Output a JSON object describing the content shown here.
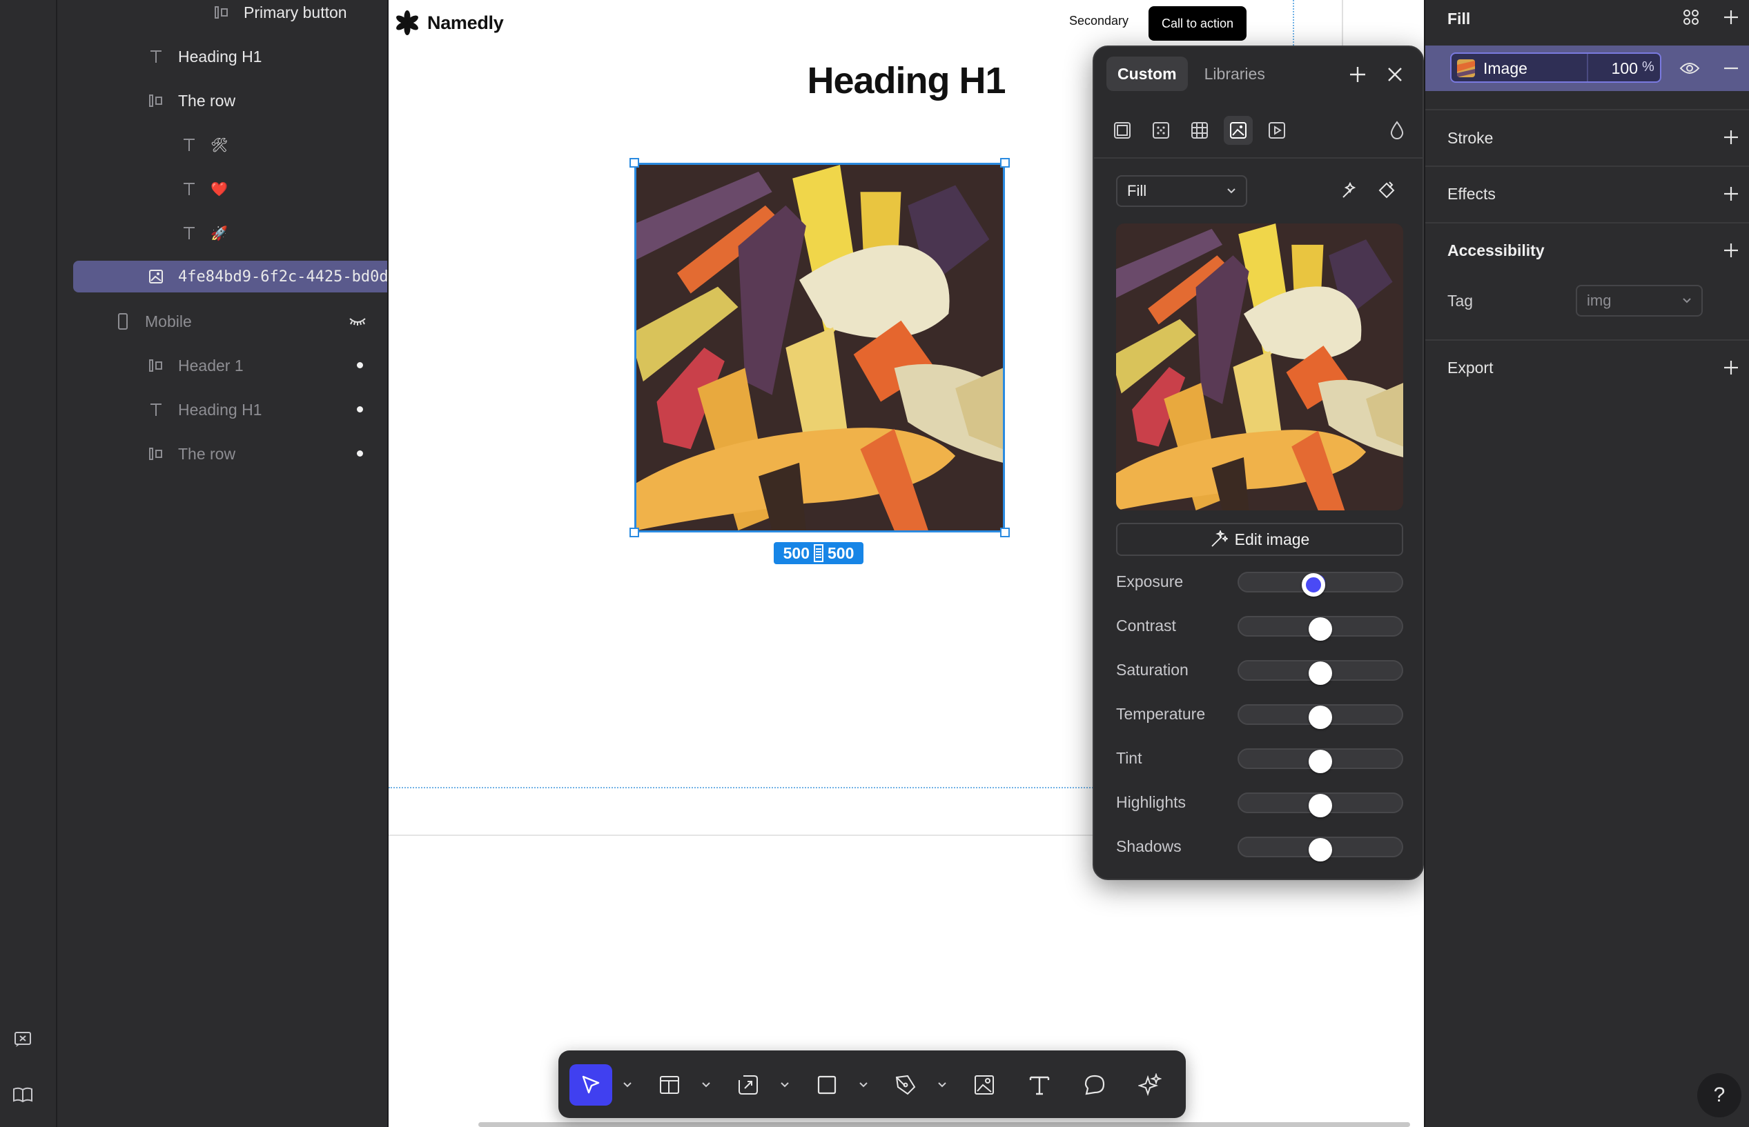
{
  "layers": {
    "items": [
      {
        "label": "Primary button",
        "icon": "frame-row-icon",
        "muted": false
      },
      {
        "label": "Heading H1",
        "icon": "text-icon",
        "muted": false
      },
      {
        "label": "The row",
        "icon": "frame-row-icon",
        "muted": false
      },
      {
        "label": "🛠",
        "icon": "text-icon",
        "muted": false
      },
      {
        "label": "❤️",
        "icon": "text-icon",
        "muted": false
      },
      {
        "label": "🚀",
        "icon": "text-icon",
        "muted": false
      },
      {
        "label": "4fe84bd9-6f2c-4425-bd0d-",
        "icon": "image-icon",
        "muted": false,
        "selected": true
      },
      {
        "label": "Mobile",
        "icon": "mobile-icon",
        "muted": true
      },
      {
        "label": "Header 1",
        "icon": "frame-row-icon",
        "muted": true
      },
      {
        "label": "Heading H1",
        "icon": "text-icon",
        "muted": true
      },
      {
        "label": "The row",
        "icon": "frame-row-icon",
        "muted": true
      }
    ]
  },
  "canvas": {
    "brand": "Namedly",
    "nav_secondary": "Secondary",
    "nav_cta": "Call to action",
    "heading": "Heading H1",
    "size_w": "500",
    "size_h": "500"
  },
  "popover": {
    "tabs": [
      "Custom",
      "Libraries"
    ],
    "active_tab": "Custom",
    "fill_mode": "Fill",
    "edit_image": "Edit image",
    "adjustments": [
      {
        "label": "Exposure",
        "value": -0.1
      },
      {
        "label": "Contrast",
        "value": 0
      },
      {
        "label": "Saturation",
        "value": 0
      },
      {
        "label": "Temperature",
        "value": 0
      },
      {
        "label": "Tint",
        "value": 0
      },
      {
        "label": "Highlights",
        "value": 0
      },
      {
        "label": "Shadows",
        "value": 0
      }
    ]
  },
  "props": {
    "fill_title": "Fill",
    "fill_type": "Image",
    "fill_opacity": "100",
    "fill_unit": "%",
    "stroke": "Stroke",
    "effects": "Effects",
    "accessibility": "Accessibility",
    "tag_label": "Tag",
    "tag_value": "img",
    "export": "Export",
    "help": "?"
  },
  "colors": {
    "accent": "#4040f0",
    "selection": "#5a5a8c",
    "canvas_selection": "#2a8ae0"
  }
}
